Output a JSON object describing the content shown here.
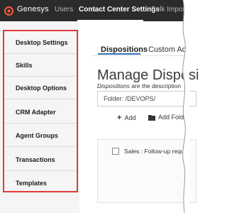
{
  "topbar": {
    "brand": "Genesys",
    "nav": [
      "Users",
      "Contact Center Settings",
      "Bulk Import"
    ],
    "active": "Contact Center Settings"
  },
  "sidebar": {
    "items": [
      {
        "label": "Desktop Settings"
      },
      {
        "label": "Skills"
      },
      {
        "label": "Desktop Options"
      },
      {
        "label": "CRM Adapter"
      },
      {
        "label": "Agent Groups"
      },
      {
        "label": "Transactions"
      },
      {
        "label": "Templates"
      }
    ]
  },
  "main": {
    "tabs": [
      {
        "label": "Dispositions",
        "active": true
      },
      {
        "label": "Custom Ad"
      }
    ],
    "title": "Manage Disposi",
    "description_em": "Dispositions",
    "description_rest": " are the description",
    "folder_value": "Folder: /DEVOPS/",
    "toolbar": {
      "add_label": "Add",
      "add_folder_label": "Add Folder"
    },
    "list": [
      {
        "label": "Sales : Follow-up requ"
      }
    ]
  },
  "colors": {
    "topbar_bg": "#2b2b2b",
    "highlight_outline": "#e03c3c",
    "tab_accent": "#2d6fb5"
  }
}
